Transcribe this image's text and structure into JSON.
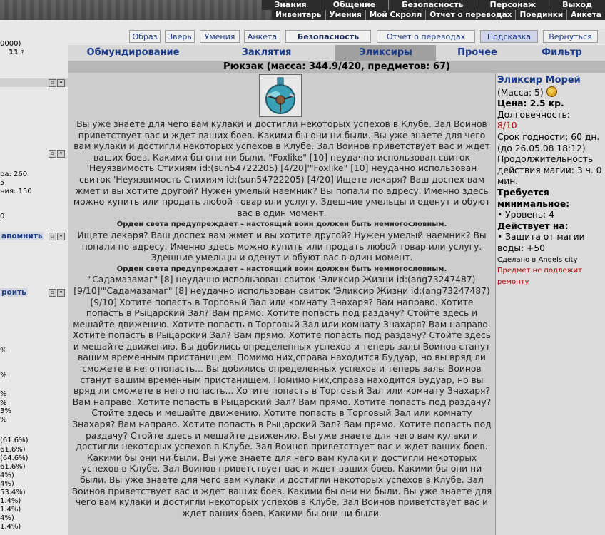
{
  "top_menu": [
    "Знания",
    "Общение",
    "Безопасность",
    "Персонаж",
    "Выход"
  ],
  "sub_menu": [
    "Инвентарь",
    "Умения",
    "Мой Скролл",
    "Отчет о переводах",
    "Поединки",
    "Анкета"
  ],
  "buttons": {
    "obraz": "Образ",
    "zver": "Зверь",
    "umeniya": "Умения",
    "anketa": "Анкета",
    "bezopasnost": "Безопасность",
    "otchet": "Отчет о переводах",
    "podskazka": "Подсказка",
    "vernutsya": "Вернуться"
  },
  "tabs": [
    "Обмундирование",
    "Заклятия",
    "Эликсиры",
    "Прочее",
    "Фильтр"
  ],
  "active_tab": "Эликсиры",
  "backpack_title": "Рюкзак (масса: 344.9/420, предметов: 67)",
  "left_panel": {
    "t1": "0000)",
    "t2": "11",
    "t3": "ра: 260",
    "t4": "5",
    "t5": "ния: 150",
    "t6": "0",
    "link1": "апомнить",
    "link2": "роить",
    "pcts": [
      "%",
      "%",
      "%",
      "%",
      "3%",
      "%",
      "(61.6%)",
      "61.6%)",
      "(64.6%)",
      "61.6%)",
      "4%)",
      "4%)",
      "53.4%)",
      "1.4%)",
      "1.4%)",
      "4%)",
      "1.4%)"
    ]
  },
  "messages": [
    {
      "text": "Вы уже знаете для чего вам кулаки и достигли некоторых успехов в Клубе. Зал Воинов приветствует вас и ждет ваших боев. Какими бы они ни были. Вы уже знаете для чего вам кулаки и достигли некоторых успехов в Клубе. Зал Воинов приветствует вас и ждет ваших боев. Какими бы они ни были. \"Foxlike\" [10] неудачно использован свиток 'Неуязвимость Стихиям id:(sun54722205) [4/20]'\"Foxlike\" [10] неудачно использован свиток 'Неуязвимость Стихиям id:(sun54722205) [4/20]'Ищете лекаря? Ваш доспех вам жмет и вы хотите другой? Нужен умелый наемник? Вы попали по адресу. Именно здесь можно купить или продать любой товар или услугу. Здешние умельцы и оденут и обуют вас в один момент.",
      "small": false
    },
    {
      "text": "Орден света предупреждает – настоящий воин должен быть немногословным.",
      "small": true
    },
    {
      "text": " Ищете лекаря? Ваш доспех вам жмет и вы хотите другой? Нужен умелый наемник? Вы попали по адресу. Именно здесь можно купить или продать любой товар или услугу. Здешние умельцы и оденут и обуют вас в один момент.",
      "small": false
    },
    {
      "text": "Орден света предупреждает – настоящий воин должен быть немногословным.",
      "small": true
    },
    {
      "text": " \"Садамазамаг\" [8] неудачно использован свиток 'Эликсир Жизни id:(ang73247487) [9/10]'\"Садамазамаг\" [8] неудачно использован свиток 'Эликсир Жизни id:(ang73247487) [9/10]'Хотите попасть в Торговый Зал или комнату Знахаря? Вам направо. Хотите попасть в Рыцарский Зал? Вам прямо. Хотите попасть под раздачу? Стойте здесь и мешайте движению. Хотите попасть в Торговый Зал или комнату Знахаря? Вам направо. Хотите попасть в Рыцарский Зал? Вам прямо. Хотите попасть под раздачу? Стойте здесь и мешайте движению. Вы добились определенных успехов и теперь залы Воинов станут вашим временным пристанищем. Помимо них,справа находится Будуар, но вы вряд ли сможете в него попасть... Вы добились определенных успехов и теперь залы Воинов станут вашим временным пристанищем. Помимо них,справа находится Будуар, но вы вряд ли сможете в него попасть... Хотите попасть в Торговый Зал или комнату Знахаря? Вам направо. Хотите попасть в Рыцарский Зал? Вам прямо. Хотите попасть под раздачу? Стойте здесь и мешайте движению. Хотите попасть в Торговый Зал или комнату Знахаря? Вам направо. Хотите попасть в Рыцарский Зал? Вам прямо. Хотите попасть под раздачу? Стойте здесь и мешайте движению. Вы уже знаете для чего вам кулаки и достигли некоторых успехов в Клубе. Зал Воинов приветствует вас и ждет ваших боев. Какими бы они ни были. Вы уже знаете для чего вам кулаки и достигли некоторых успехов в Клубе. Зал Воинов приветствует вас и ждет ваших боев. Какими бы они ни были. Вы уже знаете для чего вам кулаки и достигли некоторых успехов в Клубе. Зал Воинов приветствует вас и ждет ваших боев. Какими бы они ни были. Вы уже знаете для чего вам кулаки и достигли некоторых успехов в Клубе. Зал Воинов приветствует вас и ждет ваших боев. Какими бы они ни были.",
      "small": false
    }
  ],
  "item": {
    "name": "Эликсир Морей",
    "mass": "(Масса: 5)",
    "price": "Цена: 2.5 кр.",
    "durability_label": "Долговечность:",
    "durability_value": "8/10",
    "expiry": "Срок годности: 60 дн. (до 26.05.08 18:12)",
    "magic_duration": "Продолжительность действия магии: 3 ч. 0 мин.",
    "req_label": "Требуется минимальное:",
    "req_level": "• Уровень: 4",
    "acts_label": "Действует на:",
    "acts_effect": "• Защита от магии воды: +50",
    "made_in": "Сделано в Angels city",
    "not_repairable": "Предмет не подлежит ремонту"
  }
}
